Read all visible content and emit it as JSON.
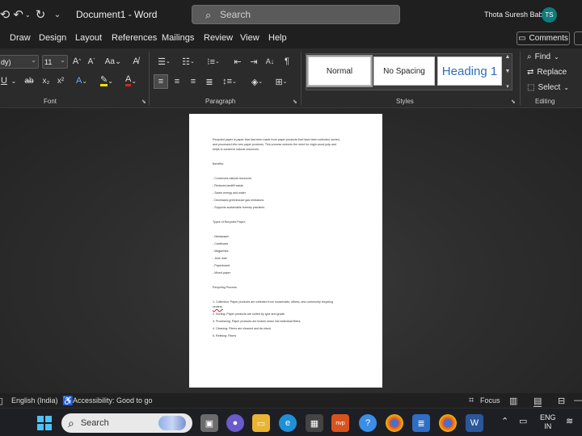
{
  "titlebar": {
    "doc_title": "Document1  -  Word",
    "search_placeholder": "Search",
    "user_name": "Thota Suresh Babu",
    "user_initials": "TS"
  },
  "menu": {
    "tabs": [
      "Draw",
      "Design",
      "Layout",
      "References",
      "Mailings",
      "Review",
      "View",
      "Help"
    ],
    "comments_label": "Comments"
  },
  "ribbon": {
    "font_name": "dy)",
    "font_size": "11",
    "groups": {
      "font": "Font",
      "paragraph": "Paragraph",
      "styles": "Styles",
      "editing": "Editing"
    },
    "styles": [
      "Normal",
      "No Spacing",
      "Heading 1"
    ],
    "editing": {
      "find": "Find",
      "replace": "Replace",
      "select": "Select"
    }
  },
  "document": {
    "intro": [
      "Recycled paper is paper that has been made from paper products that have been collected, sorted,",
      "and processed into new paper products. This process reduces the need for virgin wood pulp and",
      "helps to conserve natural resources."
    ],
    "benefits_heading": "Benefits:",
    "benefits": [
      "- Conserves natural resources",
      "- Reduces landfill waste",
      "- Saves energy and water",
      "- Decreases greenhouse gas emissions",
      "- Supports sustainable forestry practices"
    ],
    "types_heading": "Types of Recycled Paper:",
    "types": [
      "- Newspaper",
      "- Cardboard",
      "- Magazines",
      "- Junk mail",
      "- Paperboard",
      "- Mixed paper"
    ],
    "process_heading": "Recycling Process:",
    "process": [
      "1. Collection: Paper products are collected from households, offices, and community recycling",
      "centers.",
      "2. Sorting: Paper products are sorted by type and grade.",
      "3. Processing: Paper products are broken down into individual fibers.",
      "4. Cleaning: Fibers are cleaned and de-inked.",
      "5. Refining: Fibers"
    ]
  },
  "status": {
    "language": "English (India)",
    "accessibility": "Accessibility: Good to go",
    "focus": "Focus"
  },
  "taskbar": {
    "search_label": "Search",
    "lang_line1": "ENG",
    "lang_line2": "IN"
  }
}
